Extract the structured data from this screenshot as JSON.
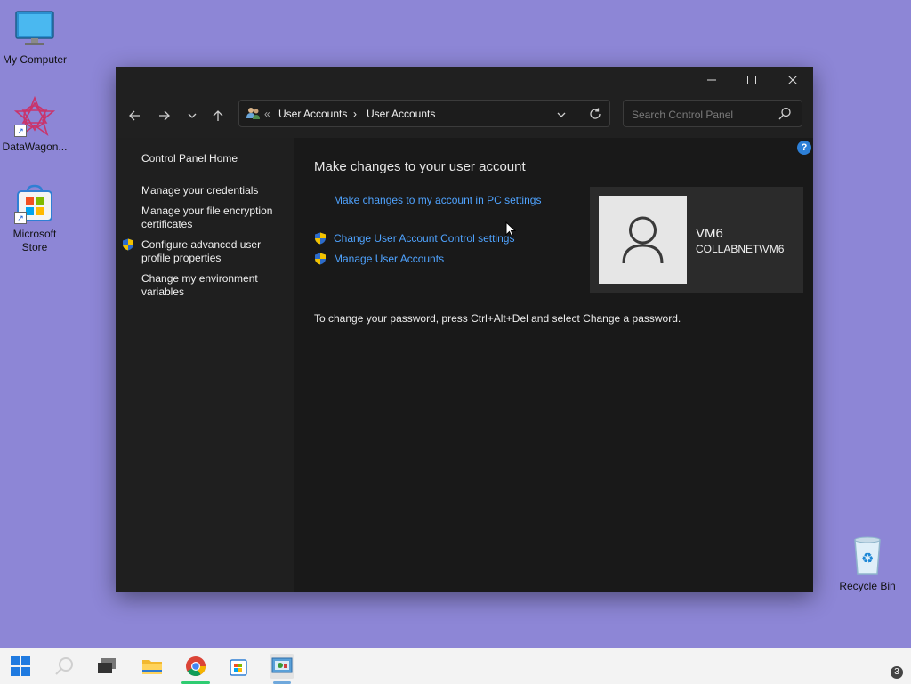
{
  "desktop": {
    "icons": [
      {
        "label": "My Computer",
        "icon": "monitor-icon"
      },
      {
        "label": "DataWagon...",
        "icon": "datawagon-icon"
      },
      {
        "label": "Microsoft Store",
        "icon": "store-icon"
      },
      {
        "label": "Recycle Bin",
        "icon": "recycle-bin-icon"
      }
    ],
    "background_color": "#8d86d6"
  },
  "window": {
    "controls": {
      "minimize": "─",
      "maximize": "☐",
      "close": "✕"
    },
    "address": {
      "overflow": "«",
      "crumbs": [
        "User Accounts",
        "User Accounts"
      ],
      "separator": "›"
    },
    "search": {
      "placeholder": "Search Control Panel"
    },
    "help": "?",
    "sidebar": {
      "items": [
        {
          "label": "Control Panel Home"
        },
        {
          "label": "Manage your credentials"
        },
        {
          "label": "Manage your file encryption certificates"
        },
        {
          "label": "Configure advanced user profile properties",
          "shield": true
        },
        {
          "label": "Change my environment variables"
        }
      ]
    },
    "main": {
      "heading": "Make changes to your user account",
      "links": [
        {
          "label": "Make changes to my account in PC settings",
          "shield": false
        },
        {
          "label": "Change User Account Control settings",
          "shield": true
        },
        {
          "label": "Manage User Accounts",
          "shield": true
        }
      ],
      "user": {
        "name": "VM6",
        "domain": "COLLABNET\\VM6"
      },
      "note": "To change your password, press Ctrl+Alt+Del and select Change a password."
    },
    "colors": {
      "link": "#4fa3ff",
      "bg": "#191919",
      "sidebar": "#1f1f1f"
    }
  },
  "taskbar": {
    "apps": [
      "start-icon",
      "search-icon",
      "task-view-icon",
      "file-explorer-icon",
      "chrome-icon",
      "store-icon",
      "control-panel-icon"
    ],
    "notification_count": "3"
  }
}
